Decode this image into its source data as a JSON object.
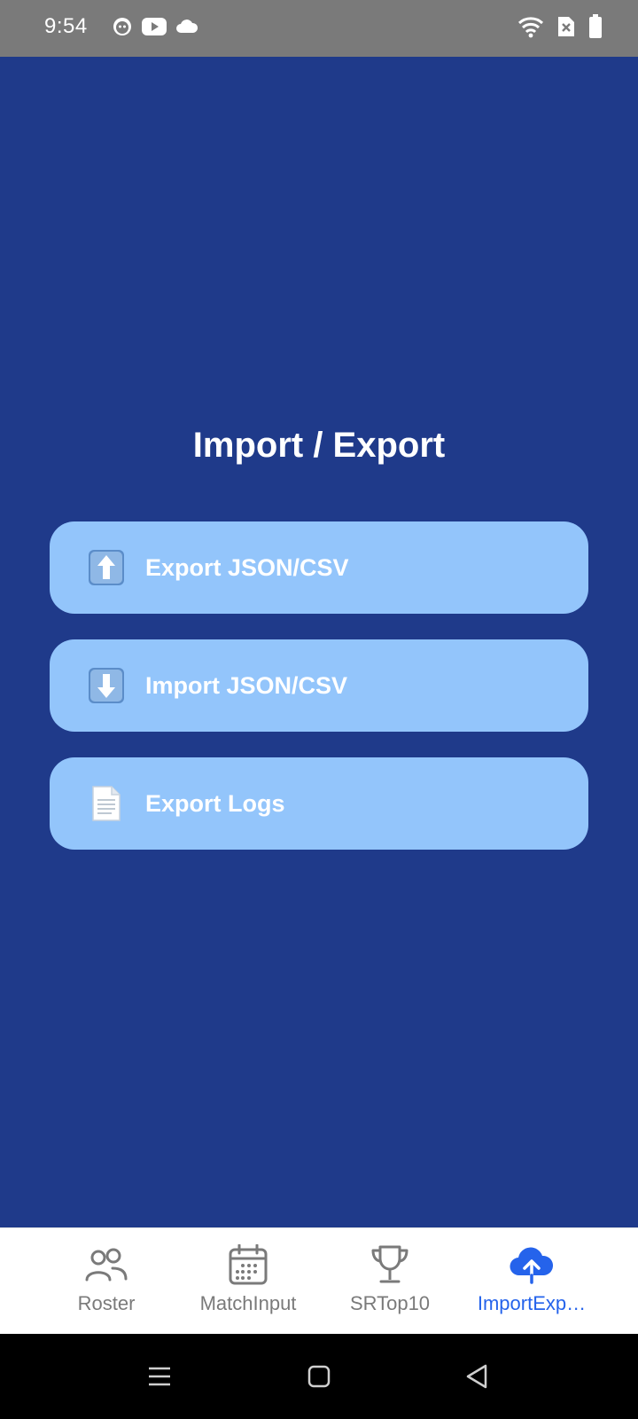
{
  "status_bar": {
    "time": "9:54",
    "left_icons": [
      "cat-notification-icon",
      "youtube-icon",
      "cloud-icon"
    ],
    "right_icons": [
      "wifi-icon",
      "sim-off-icon",
      "battery-icon"
    ]
  },
  "main": {
    "title": "Import / Export",
    "buttons": [
      {
        "label": "Export JSON/CSV",
        "icon": "upload-arrow-icon"
      },
      {
        "label": "Import JSON/CSV",
        "icon": "download-arrow-icon"
      },
      {
        "label": "Export Logs",
        "icon": "document-icon"
      }
    ]
  },
  "bottom_nav": {
    "items": [
      {
        "label": "Roster",
        "icon": "people-icon",
        "active": false
      },
      {
        "label": "MatchInput",
        "icon": "calendar-icon",
        "active": false
      },
      {
        "label": "SRTop10",
        "icon": "trophy-icon",
        "active": false
      },
      {
        "label": "ImportExp…",
        "icon": "cloud-upload-icon",
        "active": true
      }
    ]
  },
  "system_nav": {
    "buttons": [
      "recents-icon",
      "home-icon",
      "back-icon"
    ]
  },
  "colors": {
    "background": "#1F3A8A",
    "button_fill": "#93C5FB",
    "nav_active": "#2563EB",
    "nav_inactive": "#7A7A7A",
    "status_bar": "#7A7A7A"
  }
}
